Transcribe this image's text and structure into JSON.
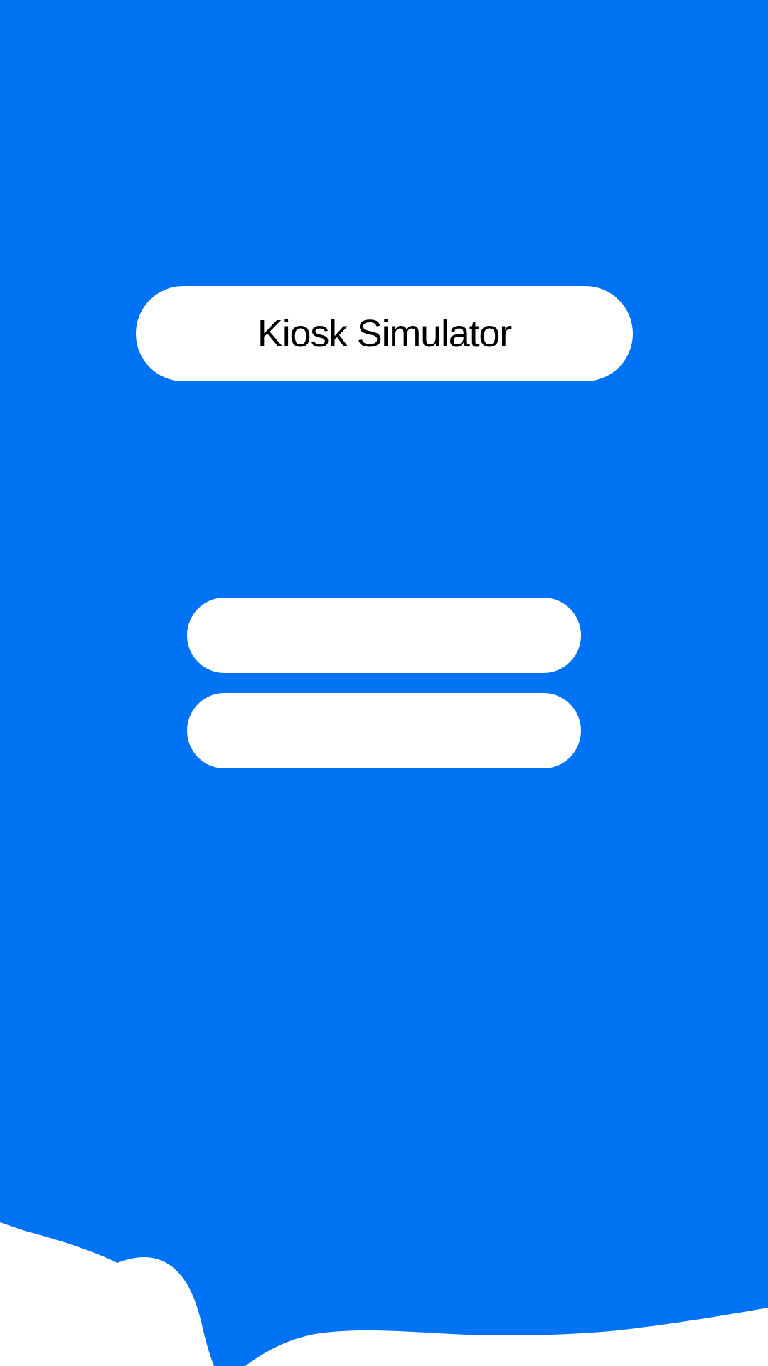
{
  "app": {
    "title": "Kiosk Simulator"
  },
  "colors": {
    "background_accent": "#0073F5",
    "pill_fill": "#FFFFFF",
    "title_text": "#000000"
  },
  "buttons": [
    {
      "label": ""
    },
    {
      "label": ""
    }
  ]
}
